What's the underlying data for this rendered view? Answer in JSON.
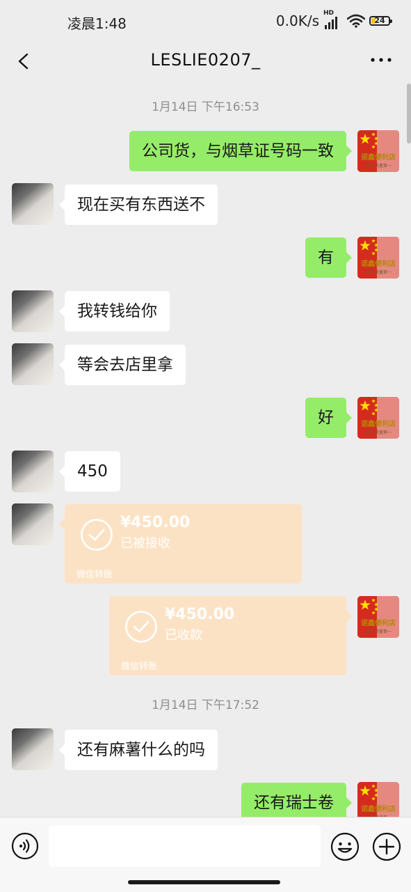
{
  "status_bar": {
    "time": "凌晨1:48",
    "network_speed": "0.0K/s",
    "signal_label": "HD",
    "battery": "24"
  },
  "header": {
    "title": "LESLIE0207_"
  },
  "avatar_store_text": {
    "line1": "诺鑫便利店",
    "line2": "诚信·质量第一"
  },
  "colors": {
    "outgoing_bubble": "#95ec69",
    "incoming_bubble": "#ffffff",
    "transfer_card": "#fce2c4",
    "background": "#ededed"
  },
  "messages": [
    {
      "kind": "timestamp",
      "text": "1月14日 下午16:53"
    },
    {
      "kind": "text",
      "side": "out",
      "text": "公司货，与烟草证号码一致"
    },
    {
      "kind": "text",
      "side": "in",
      "text": "现在买有东西送不"
    },
    {
      "kind": "text",
      "side": "out",
      "text": "有"
    },
    {
      "kind": "text",
      "side": "in",
      "text": "我转钱给你"
    },
    {
      "kind": "text",
      "side": "in",
      "text": "等会去店里拿"
    },
    {
      "kind": "text",
      "side": "out",
      "text": "好"
    },
    {
      "kind": "text",
      "side": "in",
      "text": "450"
    },
    {
      "kind": "transfer",
      "side": "in",
      "amount": "¥450.00",
      "status": "已被接收",
      "label": "微信转账"
    },
    {
      "kind": "transfer",
      "side": "out",
      "amount": "¥450.00",
      "status": "已收款",
      "label": "微信转账"
    },
    {
      "kind": "timestamp",
      "text": "1月14日 下午17:52"
    },
    {
      "kind": "text",
      "side": "in",
      "text": "还有麻薯什么的吗"
    },
    {
      "kind": "text",
      "side": "out",
      "text": "还有瑞士卷"
    }
  ],
  "input": {
    "placeholder": ""
  }
}
